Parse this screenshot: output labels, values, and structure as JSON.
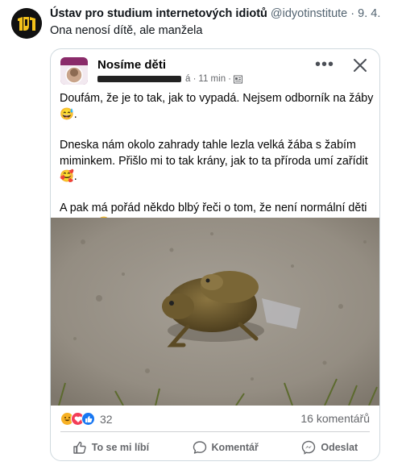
{
  "tweet": {
    "author_name": "Ústav pro studium internetových idiotů",
    "handle": "@idyotinstitute",
    "separator": "·",
    "date": "9. 4.",
    "text": "Ona nenosí dítě, ale manžela"
  },
  "fb_post": {
    "group_name": "Nosíme děti",
    "time": "11 min",
    "meta_prefix": "á ·",
    "meta_separator": "·",
    "paragraphs": [
      "Doufám, že je to tak, jak to vypadá. Nejsem odborník na žáby😅.",
      "Dneska nám okolo zahrady tahle lezla velká žába s žabím miminkem. Přišlo mi to tak krány, jak to ta příroda umí zařídit🥰.",
      "A pak má pořád někdo blbý řeči o tom, že není normální děti nosit....😒"
    ],
    "reaction_count": "32",
    "comments_count": "16 komentářů",
    "actions": {
      "like": "To se mi líbí",
      "comment": "Komentář",
      "share": "Odeslat"
    }
  },
  "icons": [
    "brand-avatar",
    "more-icon",
    "close-icon",
    "haha-reaction-icon",
    "love-reaction-icon",
    "like-reaction-icon",
    "like-icon",
    "comment-icon",
    "messenger-icon"
  ],
  "colors": {
    "twitter_gray": "#536471",
    "fb_gray": "#65676b",
    "like_blue": "#1877f2",
    "love_red": "#f33e58",
    "haha_yellow": "#f7b125"
  }
}
